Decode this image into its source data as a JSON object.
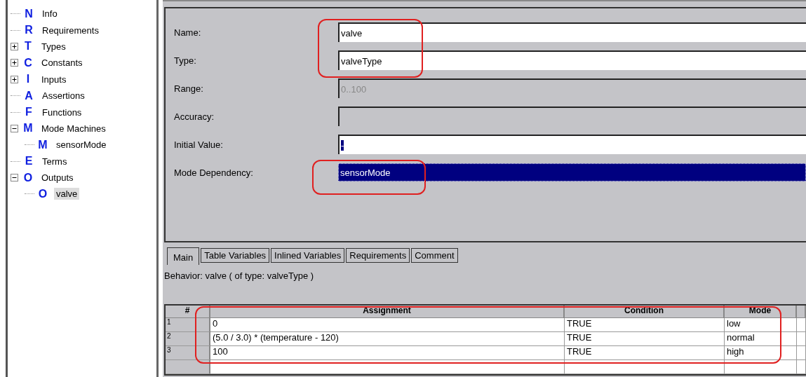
{
  "tree": [
    {
      "letter": "N",
      "label": "Info",
      "selected": false
    },
    {
      "letter": "R",
      "label": "Requirements",
      "selected": false
    },
    {
      "letter": "T",
      "label": "Types",
      "selected": false,
      "expanded": false
    },
    {
      "letter": "C",
      "label": "Constants",
      "selected": false,
      "expanded": false
    },
    {
      "letter": "I",
      "label": "Inputs",
      "selected": false,
      "expanded": false
    },
    {
      "letter": "A",
      "label": "Assertions",
      "selected": false
    },
    {
      "letter": "F",
      "label": "Functions",
      "selected": false
    },
    {
      "letter": "M",
      "label": "Mode Machines",
      "selected": false,
      "expanded": true,
      "children": [
        {
          "letter": "M",
          "label": "sensorMode",
          "selected": false
        }
      ]
    },
    {
      "letter": "E",
      "label": "Terms",
      "selected": false
    },
    {
      "letter": "O",
      "label": "Outputs",
      "selected": false,
      "expanded": true,
      "children": [
        {
          "letter": "O",
          "label": "valve",
          "selected": true
        }
      ]
    }
  ],
  "form": [
    {
      "kind": "text",
      "label": "Name:",
      "value": "valve",
      "disabled": false
    },
    {
      "kind": "text",
      "label": "Type:",
      "value": "valveType",
      "disabled": false
    },
    {
      "kind": "text",
      "label": "Range:",
      "value": "0..100",
      "disabled": true
    },
    {
      "kind": "text",
      "label": "Accuracy:",
      "disabled": true
    },
    {
      "kind": "text",
      "label": "Initial Value:",
      "value": "-",
      "disabled": false,
      "selected": true
    },
    {
      "kind": "dropdown",
      "label": "Mode Dependency:",
      "value": "sensorMode",
      "disabled": false,
      "selected": true
    }
  ],
  "tabs": [
    {
      "label": "Main",
      "selected": true
    },
    {
      "label": "Table Variables",
      "selected": false
    },
    {
      "label": "Inlined Variables",
      "selected": false
    },
    {
      "label": "Requirements",
      "selected": false
    },
    {
      "label": "Comment",
      "selected": false
    }
  ],
  "behavior": "Behavior: valve ( of type: valveType )",
  "table": {
    "columns": [
      "#",
      "Assignment",
      "Condition",
      "Mode"
    ],
    "rows": [
      {
        "number": "1",
        "cells": [
          "0",
          "TRUE",
          "low"
        ]
      },
      {
        "number": "2",
        "cells": [
          "(5.0 / 3.0) * (temperature - 120)",
          "TRUE",
          "normal"
        ]
      },
      {
        "number": "3",
        "cells": [
          "100",
          "TRUE",
          "high"
        ]
      },
      {
        "cells": []
      }
    ]
  }
}
